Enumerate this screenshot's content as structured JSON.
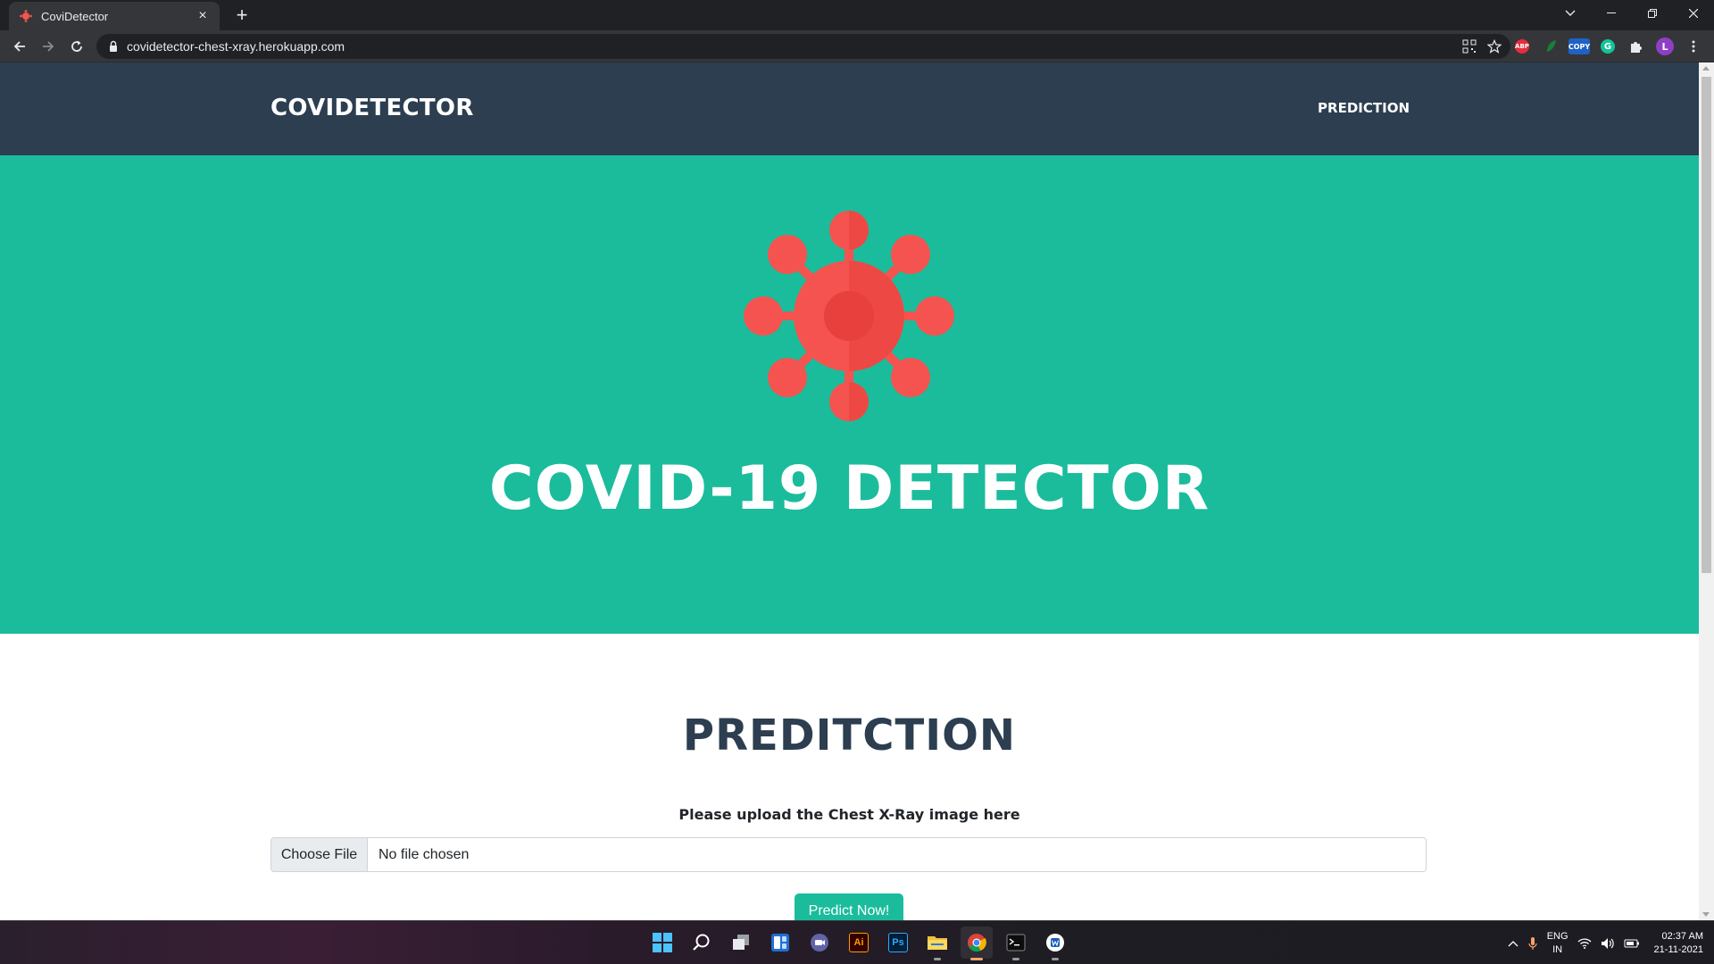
{
  "browser": {
    "tab_title": "CoviDetector",
    "url": "covidetector-chest-xray.herokuapp.com",
    "extensions": [
      {
        "name": "adblock-plus",
        "label": "ABP",
        "color": "#e52d3b"
      },
      {
        "name": "leaf-extension",
        "label": "",
        "color": "#1a7f3a"
      },
      {
        "name": "copy-extension",
        "label": "COPY",
        "color": "#1e62c4"
      },
      {
        "name": "grammarly",
        "label": "G",
        "color": "#15c39a"
      }
    ],
    "profile_initial": "L",
    "profile_color": "#8e3fc5"
  },
  "site": {
    "brand": "COVIDETECTOR",
    "nav_link": "PREDICTION",
    "masthead_title": "COVID-19 DETECTOR",
    "section_title": "PREDITCTION",
    "upload_label": "Please upload the Chest X-Ray image here",
    "file_button": "Choose File",
    "file_status": "No file chosen",
    "predict_button": "Predict Now!",
    "colors": {
      "nav_bg": "#2c3e50",
      "masthead_bg": "#1abc9c",
      "virus": "#f5534f",
      "virus_dark": "#e8403c"
    }
  },
  "taskbar": {
    "apps": [
      "start-icon",
      "search-icon",
      "task-view-icon",
      "widgets-icon",
      "teams-chat-icon",
      "illustrator-icon",
      "photoshop-icon",
      "file-explorer-icon",
      "chrome-icon",
      "terminal-icon",
      "word-app-icon"
    ],
    "illustrator_label": "Ai",
    "photoshop_label": "Ps",
    "lang_line1": "ENG",
    "lang_line2": "IN",
    "time": "02:37 AM",
    "date": "21-11-2021"
  }
}
